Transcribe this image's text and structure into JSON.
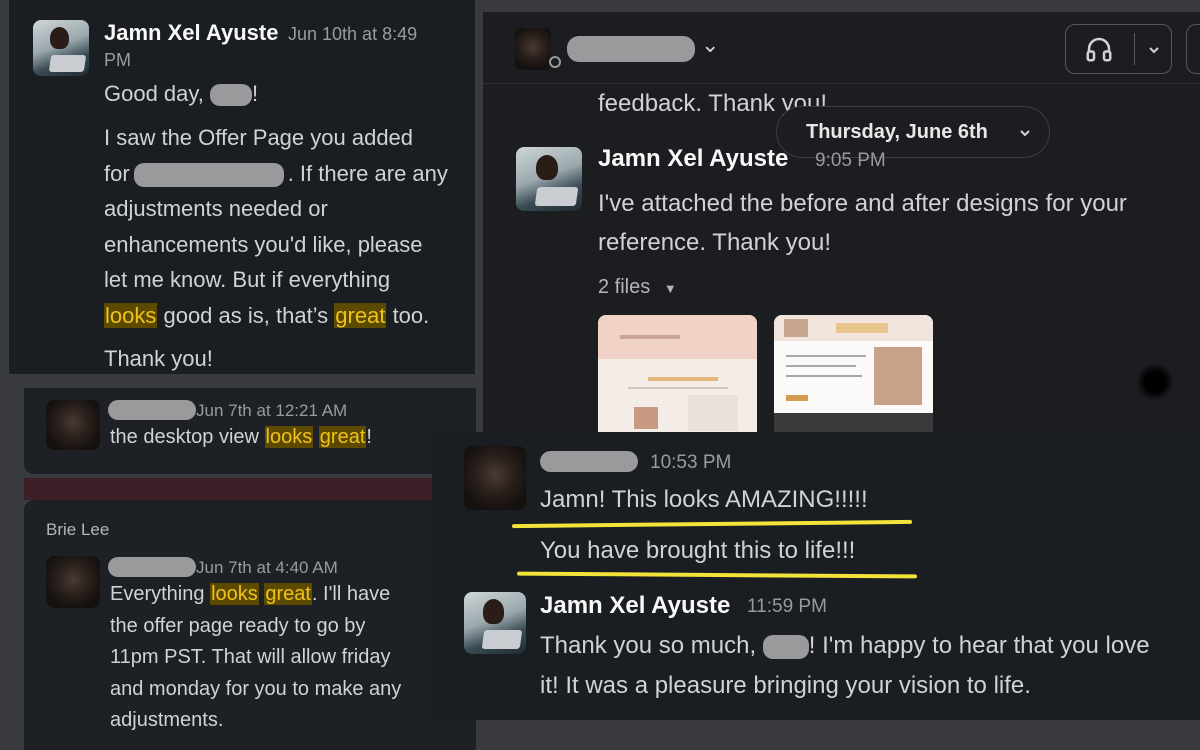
{
  "panel_a": {
    "sender": "Jamn Xel Ayuste",
    "timestamp": "Jun 10th at 8:49",
    "timestamp_cont": "PM",
    "greeting_pre": "Good day, ",
    "greeting_post": "!",
    "p1_l1": "I saw the Offer Page you added",
    "p1_l2a": "for",
    "p1_l2b": ". If there are any",
    "p1_l3": "adjustments needed or",
    "p1_l4": "enhancements you'd like, please",
    "p1_l5": "let me know. But if everything",
    "p1_l6_hl1": "looks",
    "p1_l6_mid": " good as is, that’s ",
    "p1_l6_hl2": "great",
    "p1_l6_end": " too.",
    "closing": "Thank you!"
  },
  "panel_b": {
    "timestamp": "Jun 7th at 12:21 AM",
    "text_pre": "the desktop view ",
    "hl1": "looks",
    "hl2": "great",
    "text_post": "!"
  },
  "panel_c": {
    "channel_name": "Brie Lee",
    "timestamp": "Jun 7th at 4:40 AM",
    "l1_pre": "Everything ",
    "l1_hl1": "looks",
    "l1_hl2": "great",
    "l1_post": ". I'll have",
    "l2": "the offer page ready to go by",
    "l3": "11pm PST. That will allow friday",
    "l4": "and monday for you to make any",
    "l5": "adjustments."
  },
  "panel_d": {
    "header": {
      "chevron": "⌄",
      "headset_icon": "headphones-icon"
    },
    "prev_line": "feedback. Thank you!",
    "date_divider": "Thursday, June 6th",
    "sender": "Jamn Xel Ayuste",
    "timestamp": "9:05 PM",
    "line1": "I've attached the before and after designs for your",
    "line2": "reference. Thank you!",
    "files_label": "2 files"
  },
  "panel_e": {
    "msg1_time": "10:53 PM",
    "msg1_line1": "Jamn! This looks AMAZING!!!!!",
    "msg1_line2": "You have brought this to life!!!",
    "msg2_sender": "Jamn Xel Ayuste",
    "msg2_time": "11:59 PM",
    "msg2_l1_pre": "Thank you so much, ",
    "msg2_l1_post": "! I'm happy to hear that you love",
    "msg2_l2": "it! It was a pleasure bringing your vision to life."
  },
  "colors": {
    "highlight_text": "#f1c21b",
    "highlight_bg": "#5c4a00",
    "underline": "#f2e23a",
    "background": "#1a1d21"
  }
}
